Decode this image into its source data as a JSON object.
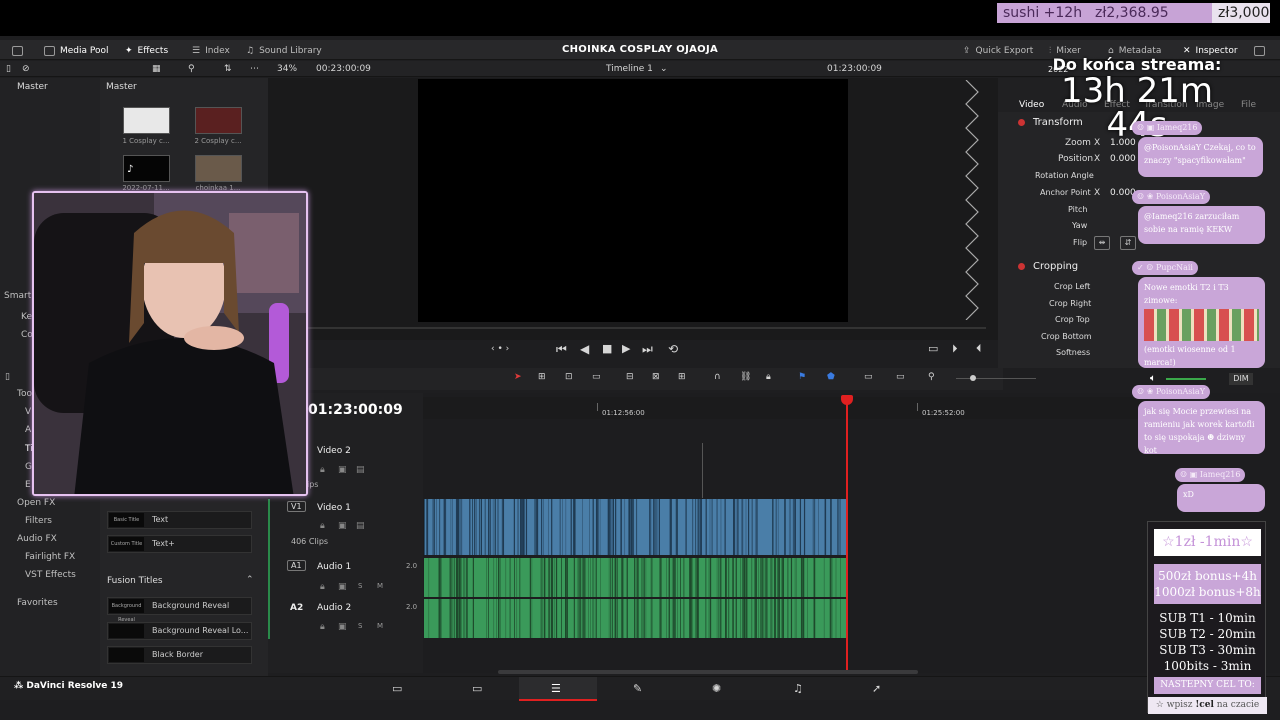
{
  "donations": {
    "item1": "sushi +12h",
    "item2": "zł2,368.95",
    "item3": "zł3,000"
  },
  "menu": {
    "media_pool": "Media Pool",
    "effects": "Effects",
    "index": "Index",
    "sound_library": "Sound Library",
    "quick_export": "Quick Export",
    "mixer": "Mixer",
    "metadata": "Metadata",
    "inspector": "Inspector"
  },
  "project_title": "CHOINKA COSPLAY OJAOJA",
  "toolbar": {
    "zoom": "34%",
    "source_timecode": "00:23:00:09",
    "timeline_name": "Timeline 1",
    "record_timecode": "01:23:00:09"
  },
  "media_pool": {
    "left_header": "Master",
    "right_header": "Master",
    "thumbs": [
      {
        "label": "1 Cosplay c..."
      },
      {
        "label": "2 Cosplay c..."
      },
      {
        "label": "2022-07-11..."
      },
      {
        "label": "choinkaa 1..."
      }
    ]
  },
  "left_panel": {
    "smart": "Smart",
    "key": "Ke",
    "col": "Co",
    "toolbox": "Too",
    "v": "V",
    "a": "A",
    "ti": "Ti",
    "g": "G",
    "e": "E",
    "open_fx": "Open FX",
    "filters": "Filters",
    "audio_fx": "Audio FX",
    "fairlight_fx": "Fairlight FX",
    "vst_effects": "VST Effects",
    "favorites": "Favorites"
  },
  "effects": {
    "items_top": [
      {
        "thumb": "Basic Title",
        "label": "Text"
      },
      {
        "thumb": "Custom Title",
        "label": "Text+"
      }
    ],
    "fusion_header": "Fusion Titles",
    "fusion_items": [
      {
        "thumb": "Background Reveal",
        "label": "Background Reveal"
      },
      {
        "thumb": "",
        "label": "Background Reveal Lo..."
      },
      {
        "thumb": "",
        "label": "Black Border"
      }
    ]
  },
  "inspector": {
    "tabs": [
      "Video",
      "Audio",
      "Effect",
      "Transition",
      "Image",
      "File"
    ],
    "transform": "Transform",
    "zoom_label": "Zoom",
    "zoom_x": "1.000",
    "position_label": "Position",
    "position_x": "0.000",
    "rotation_label": "Rotation Angle",
    "anchor_label": "Anchor Point",
    "anchor_x": "0.000",
    "pitch_label": "Pitch",
    "yaw_label": "Yaw",
    "flip_label": "Flip",
    "x_label": "X",
    "cropping": "Cropping",
    "crop_left": "Crop Left",
    "crop_right": "Crop Right",
    "crop_top": "Crop Top",
    "crop_bottom": "Crop Bottom",
    "softness": "Softness",
    "dim": "DIM"
  },
  "timeline": {
    "timecode": "01:23:00:09",
    "ruler_1": "01:12:56:00",
    "ruler_2": "01:25:52:00",
    "tracks": {
      "video2": "Video 2",
      "v1_badge": "V1",
      "video1": "Video 1",
      "clips": "406 Clips",
      "clips_top": "ips",
      "a1_badge": "A1",
      "audio1": "Audio 1",
      "a2_badge": "A2",
      "audio2": "Audio 2",
      "level1": "2.0",
      "level2": "2.0",
      "s": "S",
      "m": "M"
    }
  },
  "app_name": "DaVinci Resolve 19",
  "overlay": {
    "countdown_label": "Do końca streama:",
    "countdown_time": "13h 21m 44s",
    "date_fragment": "2022"
  },
  "chat": [
    {
      "user": "Iameq216",
      "text": "@PoisonAsiaY Czekaj, co to znaczy \"spacyfikowałam\""
    },
    {
      "user": "PoisonAsiaY",
      "text": "@Iameq216 zarzuciłam sobie na ramię KEKW"
    },
    {
      "user": "PupcNaii",
      "text": "Nowe emotki T2 i T3 zimowe:",
      "text2": "(emotki wiosenne od 1 marca!)"
    },
    {
      "user": "PoisonAsiaY",
      "text": "jak się Mocie przewiesi na ramieniu jak worek kartofli to się uspokaja",
      "text2": "dziwny kot"
    },
    {
      "user": "Iameq216",
      "text": "xD"
    }
  ],
  "goal": {
    "rate": "☆1zł -1min☆",
    "bonus1": "500zł bonus+4h",
    "bonus2": "1000zł bonus+8h",
    "sub_t1": "SUB T1 - 10min",
    "sub_t2": "SUB T2 - 20min",
    "sub_t3": "SUB T3 - 30min",
    "bits": "100bits - 3min",
    "next_goal": "NASTEPNY CEL TO:",
    "command_pre": "wpisz",
    "command": "!cel",
    "command_post": "na czacie"
  },
  "colors": {
    "accent_purple": "#c9a6d8",
    "playhead": "#e02020",
    "video_clip": "#4a7ea8",
    "audio_clip": "#3a9a5a"
  }
}
